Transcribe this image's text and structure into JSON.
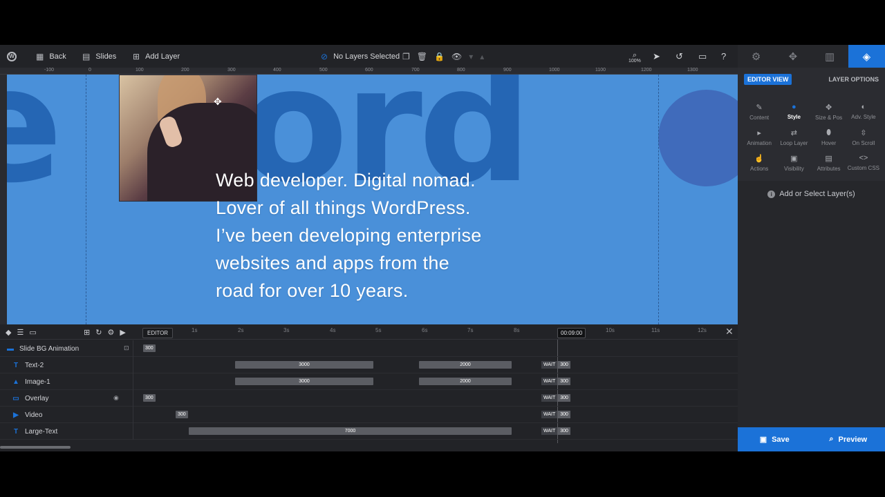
{
  "toolbar": {
    "back": "Back",
    "slides": "Slides",
    "add_layer": "Add Layer",
    "selection": "No Layers Selected",
    "zoom": "100%"
  },
  "ruler": [
    "-100",
    "0",
    "100",
    "200",
    "300",
    "400",
    "500",
    "600",
    "700",
    "800",
    "900",
    "1000",
    "1100",
    "1200",
    "1300"
  ],
  "canvas": {
    "big_text": "e Nord",
    "headline": [
      "Web developer. Digital nomad.",
      "Lover of all things WordPress.",
      "I’ve been developing enterprise",
      "websites and apps from the",
      "road for over 10 years."
    ]
  },
  "panel": {
    "editor_view": "EDITOR VIEW",
    "layer_options": "LAYER OPTIONS",
    "options": [
      {
        "label": "Content",
        "icon": "pencil-icon"
      },
      {
        "label": "Style",
        "icon": "palette-icon"
      },
      {
        "label": "Size & Pos",
        "icon": "move-icon"
      },
      {
        "label": "Adv. Style",
        "icon": "contrast-icon"
      },
      {
        "label": "Animation",
        "icon": "play-icon"
      },
      {
        "label": "Loop Layer",
        "icon": "loop-icon"
      },
      {
        "label": "Hover",
        "icon": "mouse-icon"
      },
      {
        "label": "On Scroll",
        "icon": "scroll-icon"
      },
      {
        "label": "Actions",
        "icon": "hand-icon"
      },
      {
        "label": "Visibility",
        "icon": "visibility-icon"
      },
      {
        "label": "Attributes",
        "icon": "document-icon"
      },
      {
        "label": "Custom CSS",
        "icon": "code-icon"
      }
    ],
    "hint": "Add or Select Layer(s)",
    "save": "Save",
    "preview": "Preview"
  },
  "timeline": {
    "editor_tag": "EDITOR",
    "ticks": [
      "1s",
      "2s",
      "3s",
      "4s",
      "5s",
      "6s",
      "7s",
      "8s",
      "10s",
      "11s",
      "12s"
    ],
    "time": "00:09:00",
    "rows": [
      {
        "name": "Slide BG Animation"
      },
      {
        "name": "Text-2"
      },
      {
        "name": "Image-1"
      },
      {
        "name": "Overlay"
      },
      {
        "name": "Video"
      },
      {
        "name": "Large-Text"
      }
    ],
    "bars": {
      "bg": "300",
      "text_in": "3000",
      "text_out": "2000",
      "image_in": "3000",
      "image_out": "2000",
      "overlay": "300",
      "video": "300",
      "large": "7000",
      "wait": "WAIT",
      "wait_val": "300"
    }
  },
  "colors": {
    "accent": "#1b72d8",
    "canvas_bg": "#4a90d9",
    "app_bg": "#222327"
  }
}
